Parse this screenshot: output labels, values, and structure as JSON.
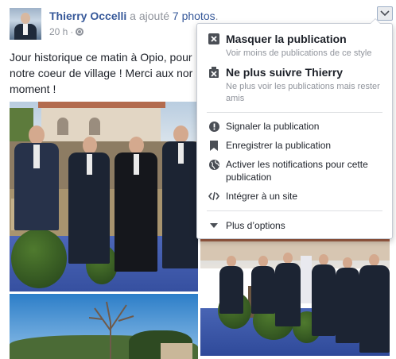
{
  "post": {
    "author": "Thierry Occelli",
    "action": " a ajouté ",
    "photos_link": "7 photos",
    "period": ".",
    "time": "20 h",
    "dot": "·",
    "text_lines": [
      "Jour historique ce matin à Opio, pour",
      "notre coeur de village ! Merci aux nor",
      "moment !"
    ]
  },
  "menu": {
    "hide": {
      "label": "Masquer la publication",
      "sub": "Voir moins de publications de ce style"
    },
    "unfollow": {
      "label": "Ne plus suivre Thierry",
      "sub_1": "Ne plus voir les publications mais rester",
      "sub_2": "amis"
    },
    "report": {
      "label": "Signaler la publication"
    },
    "save": {
      "label": "Enregistrer la publication"
    },
    "notify": {
      "label_1": "Activer les notifications pour cette",
      "label_2": "publication"
    },
    "embed": {
      "label": "Intégrer à un site"
    },
    "more": {
      "label": "Plus d’options"
    }
  },
  "colors": {
    "link": "#365899",
    "muted": "#90949c",
    "text": "#1d2129",
    "menu_border": "#c6cbd4"
  },
  "icons": [
    "close-box-icon",
    "unfollow-icon",
    "alert-icon",
    "bookmark-icon",
    "globe-icon",
    "code-icon",
    "caret-down-icon",
    "chevron-down-icon"
  ]
}
